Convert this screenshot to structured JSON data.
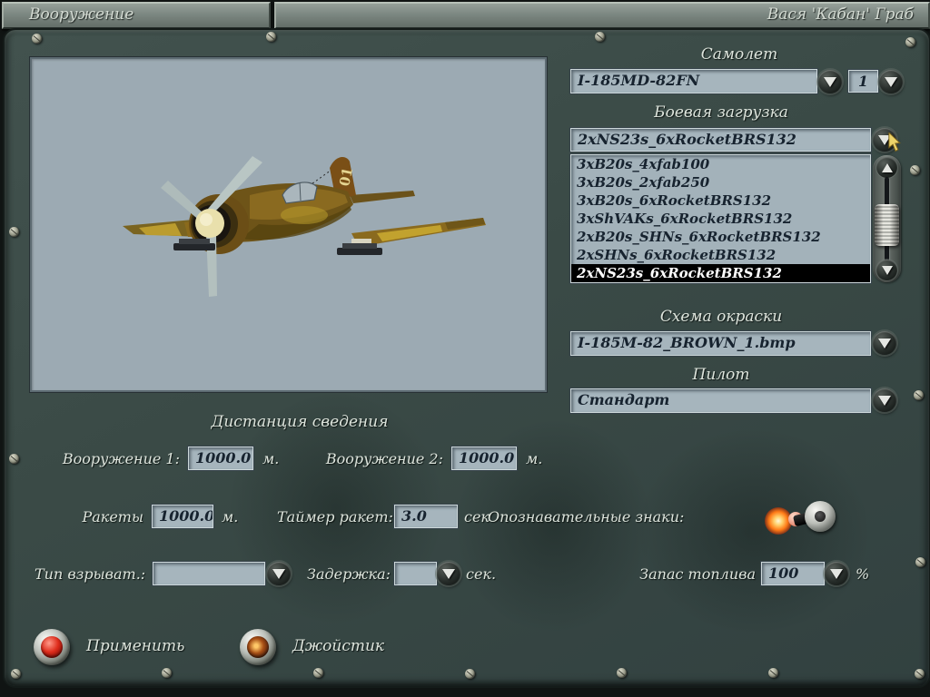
{
  "title_bar": {
    "left": "Вооружение",
    "right": "Вася 'Кабан' Граб"
  },
  "aircraft_section": {
    "label": "Самолет",
    "value": "I-185MD-82FN",
    "count": "1",
    "tail_number": "01"
  },
  "loadout_section": {
    "label": "Боевая загрузка",
    "value": "2xNS23s_6xRocketBRS132",
    "selected_index": 6,
    "options": [
      "3xB20s_4xfab100",
      "3xB20s_2xfab250",
      "3xB20s_6xRocketBRS132",
      "3xShVAKs_6xRocketBRS132",
      "2xB20s_SHNs_6xRocketBRS132",
      "2xSHNs_6xRocketBRS132",
      "2xNS23s_6xRocketBRS132"
    ]
  },
  "paint_section": {
    "label": "Схема окраски",
    "value": "I-185M-82_BROWN_1.bmp"
  },
  "pilot_section": {
    "label": "Пилот",
    "value": "Стандарт"
  },
  "convergence": {
    "title": "Дистанция сведения",
    "weapon1": {
      "label": "Вооружение 1:",
      "value": "1000.0",
      "unit": "м."
    },
    "weapon2": {
      "label": "Вооружение 2:",
      "value": "1000.0",
      "unit": "м."
    },
    "rockets": {
      "label": "Ракеты",
      "value": "1000.0",
      "unit": "м."
    },
    "rocket_timer": {
      "label": "Таймер ракет:",
      "value": "3.0",
      "unit": "сек"
    },
    "markings": {
      "label": "Опознавательные знаки:",
      "state": "on"
    },
    "fuse_type": {
      "label": "Тип взрыват.:",
      "value": ""
    },
    "delay": {
      "label": "Задержка:",
      "value": "",
      "unit": "сек."
    },
    "fuel": {
      "label": "Запас топлива",
      "value": "100",
      "unit": "%"
    }
  },
  "footer": {
    "apply_label": "Применить",
    "joystick_label": "Джойстик"
  },
  "colors": {
    "panel": "#3a4a46",
    "field_bg": "#a6b5bd",
    "selected_bg": "#000000",
    "selected_text": "#ffffff",
    "label_text": "#dde4dc",
    "value_text": "#17232f",
    "apply_button": "#df2d1c",
    "toggle_glow": "#ff7a16",
    "cursor": "#ecd36a"
  }
}
